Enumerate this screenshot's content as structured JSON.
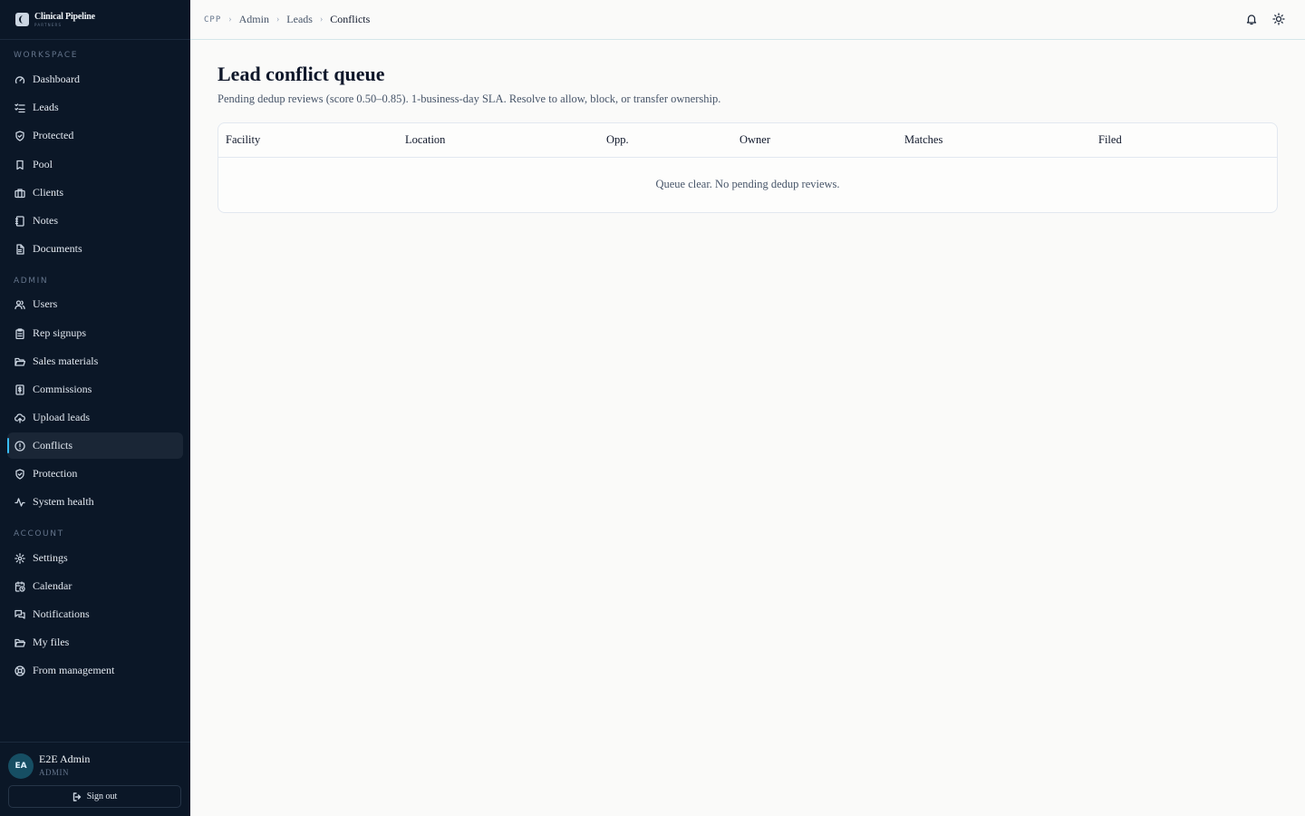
{
  "brand": {
    "name": "Clinical Pipeline",
    "sub": "PARTNERS"
  },
  "sidebar": {
    "workspace_label": "WORKSPACE",
    "workspace": [
      {
        "label": "Dashboard",
        "icon": "gauge-icon"
      },
      {
        "label": "Leads",
        "icon": "list-check-icon"
      },
      {
        "label": "Protected",
        "icon": "shield-check-icon"
      },
      {
        "label": "Pool",
        "icon": "bookmark-icon"
      },
      {
        "label": "Clients",
        "icon": "briefcase-icon"
      },
      {
        "label": "Notes",
        "icon": "notebook-icon"
      },
      {
        "label": "Documents",
        "icon": "file-text-icon"
      }
    ],
    "admin_label": "ADMIN",
    "admin": [
      {
        "label": "Users",
        "icon": "users-icon"
      },
      {
        "label": "Rep signups",
        "icon": "clipboard-icon"
      },
      {
        "label": "Sales materials",
        "icon": "folder-open-icon"
      },
      {
        "label": "Commissions",
        "icon": "receipt-dollar-icon"
      },
      {
        "label": "Upload leads",
        "icon": "cloud-upload-icon"
      },
      {
        "label": "Conflicts",
        "icon": "alert-circle-icon",
        "active": true
      },
      {
        "label": "Protection",
        "icon": "shield-check-icon"
      },
      {
        "label": "System health",
        "icon": "activity-icon"
      }
    ],
    "account_label": "ACCOUNT",
    "account": [
      {
        "label": "Settings",
        "icon": "gear-icon"
      },
      {
        "label": "Calendar",
        "icon": "calendar-clock-icon"
      },
      {
        "label": "Notifications",
        "icon": "messages-icon"
      },
      {
        "label": "My files",
        "icon": "folder-open-icon"
      },
      {
        "label": "From management",
        "icon": "lifebuoy-icon"
      }
    ]
  },
  "user": {
    "initials": "EA",
    "name": "E2E Admin",
    "role": "ADMIN",
    "signout": "Sign out"
  },
  "breadcrumb": {
    "root": "CPP",
    "items": [
      "Admin",
      "Leads"
    ],
    "current": "Conflicts"
  },
  "page": {
    "title": "Lead conflict queue",
    "description": "Pending dedup reviews (score 0.50–0.85). 1-business-day SLA. Resolve to allow, block, or transfer ownership."
  },
  "table": {
    "columns": [
      "Facility",
      "Location",
      "Opp.",
      "Owner",
      "Matches",
      "Filed"
    ],
    "empty_message": "Queue clear. No pending dedup reviews."
  },
  "colors": {
    "sidebar_bg": "#0b1727",
    "accent": "#38bdf8",
    "page_bg": "#fafaf9"
  }
}
